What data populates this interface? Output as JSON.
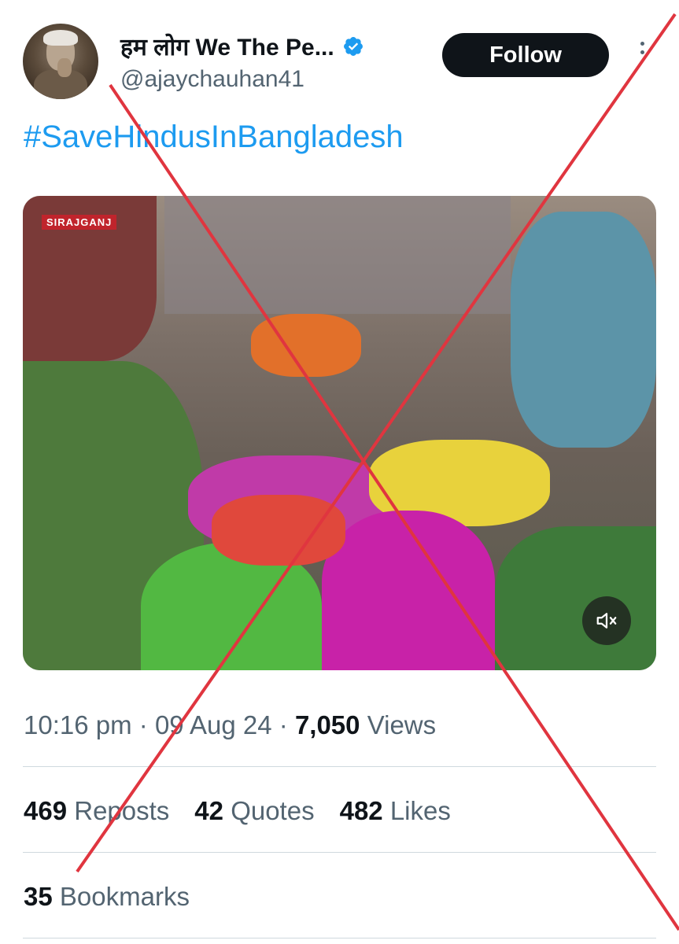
{
  "tweet": {
    "author": {
      "display_name": "हम लोग We The Pe...",
      "handle": "@ajaychauhan41",
      "verified": true,
      "avatar_icon": "avatar-photo"
    },
    "follow_label": "Follow",
    "more_icon": "more-vertical-icon",
    "text": "#SaveHindusInBangladesh",
    "media": {
      "type": "video",
      "overlay_logo": "SIRAJGANJ",
      "mute_icon": "volume-muted-icon"
    },
    "meta": {
      "time": "10:16 pm",
      "separator": "·",
      "date": "09 Aug 24",
      "views_count": "7,050",
      "views_label": "Views"
    },
    "stats": {
      "reposts_count": "469",
      "reposts_label": "Reposts",
      "quotes_count": "42",
      "quotes_label": "Quotes",
      "likes_count": "482",
      "likes_label": "Likes",
      "bookmarks_count": "35",
      "bookmarks_label": "Bookmarks"
    }
  },
  "overlay": {
    "type": "red-cross",
    "color": "#e0353f"
  },
  "colors": {
    "link": "#1d9bf0",
    "primary_text": "#0f1419",
    "secondary_text": "#536471",
    "divider": "#cfd9de",
    "verified_badge": "#1d9bf0"
  }
}
